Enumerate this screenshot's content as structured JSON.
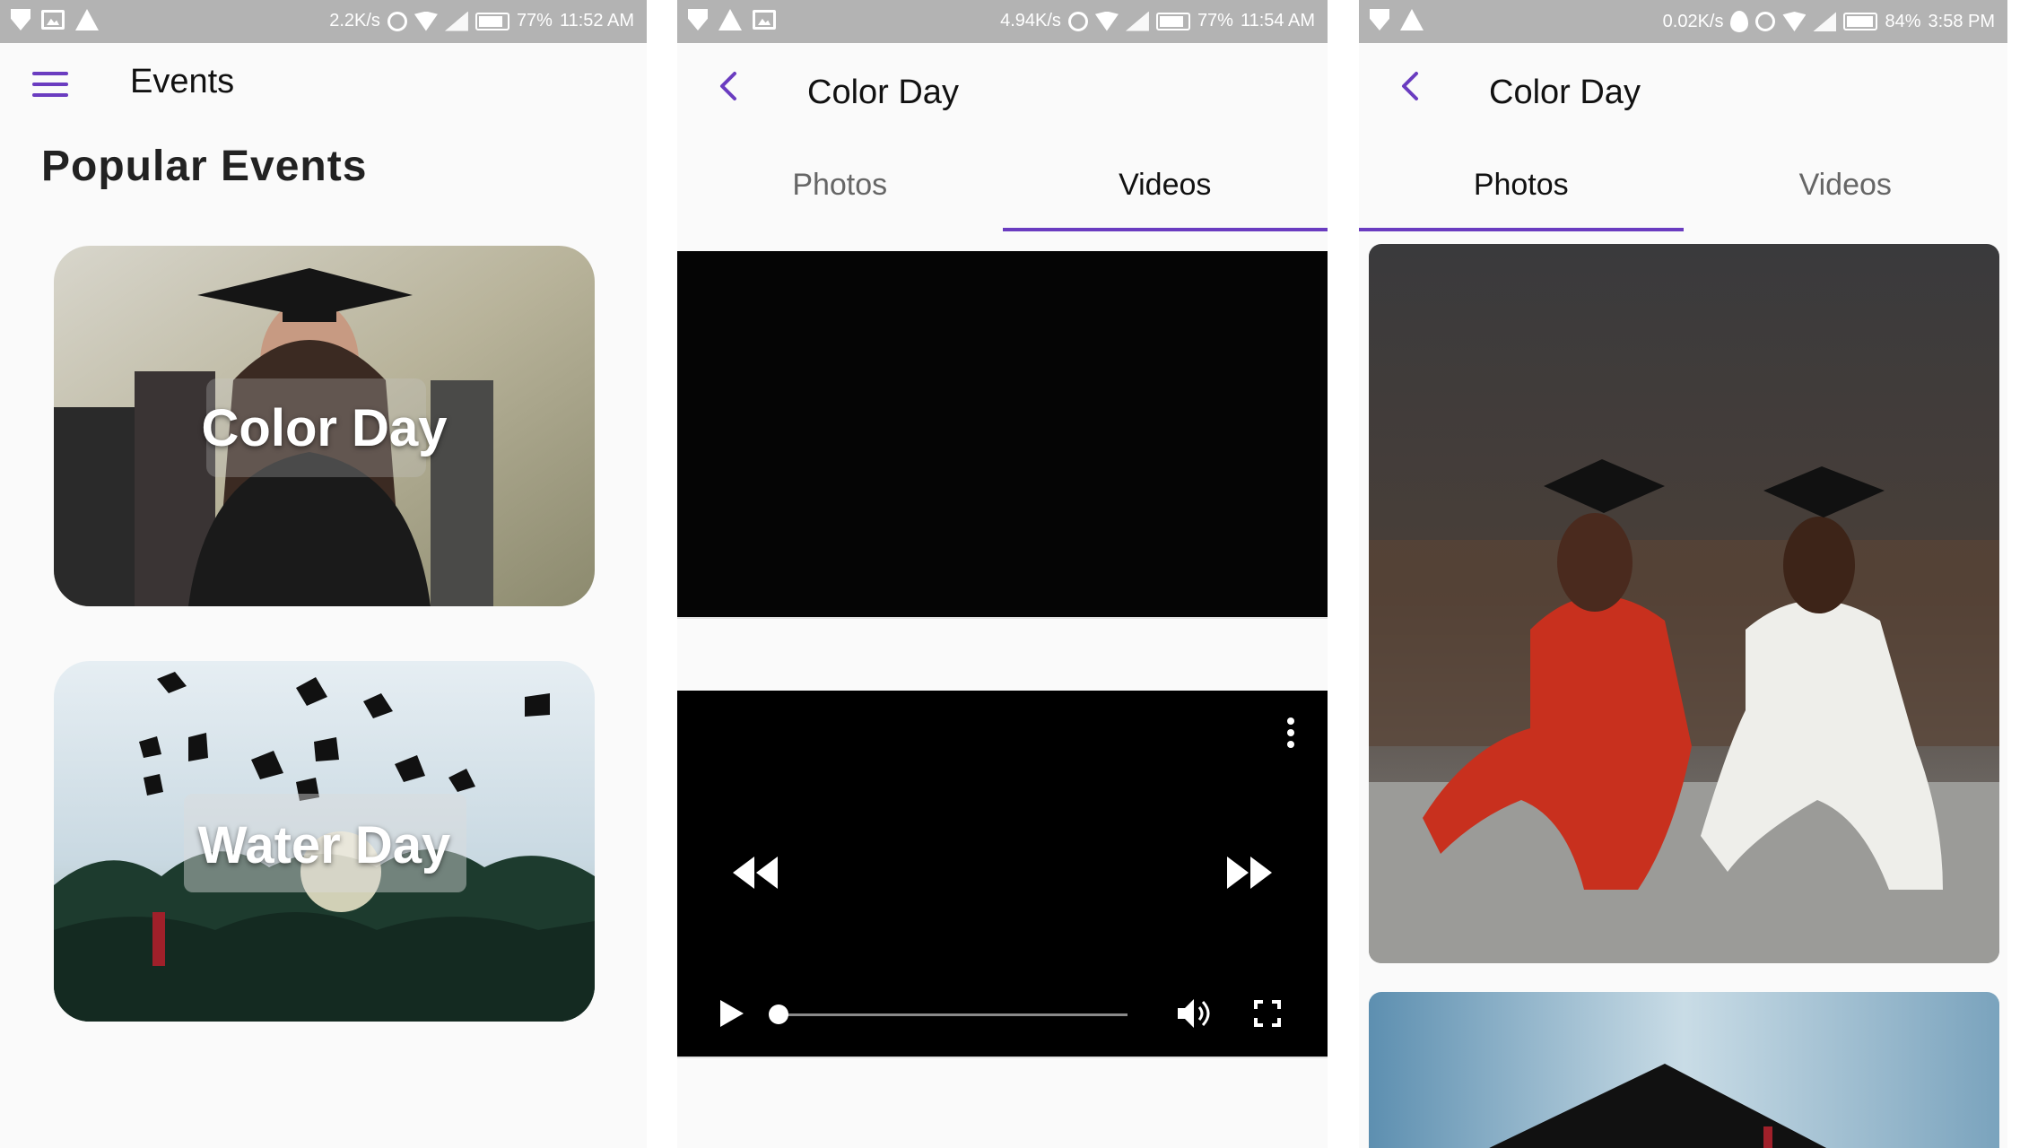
{
  "screens": [
    {
      "status": {
        "speed": "2.2K/s",
        "battery": "77%",
        "time": "11:52 AM"
      },
      "appbar": {
        "title": "Events"
      },
      "section_title": "Popular Events",
      "events": [
        {
          "label": "Color Day"
        },
        {
          "label": "Water Day"
        }
      ]
    },
    {
      "status": {
        "speed": "4.94K/s",
        "battery": "77%",
        "time": "11:54 AM"
      },
      "appbar": {
        "title": "Color Day"
      },
      "tabs": [
        {
          "label": "Photos",
          "active": false
        },
        {
          "label": "Videos",
          "active": true
        }
      ],
      "videos": [
        {
          "state": "loading"
        },
        {
          "state": "paused",
          "progress": 0
        }
      ]
    },
    {
      "status": {
        "speed": "0.02K/s",
        "battery": "84%",
        "time": "3:58 PM"
      },
      "appbar": {
        "title": "Color Day"
      },
      "tabs": [
        {
          "label": "Photos",
          "active": true
        },
        {
          "label": "Videos",
          "active": false
        }
      ]
    }
  ],
  "colors": {
    "accent": "#6a3cc0",
    "status_bar": "#b3b3b3"
  },
  "icons": [
    "shield-icon",
    "warning-icon",
    "image-icon",
    "alarm-icon",
    "wifi-icon",
    "signal-icon",
    "battery-icon",
    "menu-icon",
    "back-arrow-icon",
    "rewind-icon",
    "fast-forward-icon",
    "play-icon",
    "volume-icon",
    "fullscreen-icon",
    "more-vert-icon"
  ]
}
